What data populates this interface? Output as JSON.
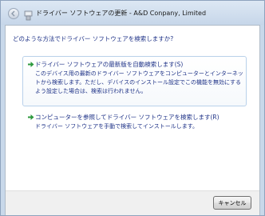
{
  "window": {
    "title": "ドライバー ソフトウェアの更新 - A&D Conpany, Limited"
  },
  "main": {
    "question": "どのような方法でドライバー ソフトウェアを検索しますか?",
    "options": [
      {
        "title": "ドライバー ソフトウェアの最新版を自動検索します(S)",
        "description": "このデバイス用の最新のドライバー ソフトウェアをコンピューターとインターネットから検索します。ただし、デバイスのインストール設定でこの機能を無効にするよう設定した場合は、検索は行われません。"
      },
      {
        "title": "コンピューターを参照してドライバー ソフトウェアを検索します(R)",
        "description": "ドライバー ソフトウェアを手動で検索してインストールします。"
      }
    ]
  },
  "footer": {
    "cancel_label": "キャンセル"
  },
  "colors": {
    "link_text": "#1e3287",
    "option_arrow": "#2e9a3e",
    "highlight_border": "#b9d1ea",
    "frame": "#c8d8ea"
  },
  "icons": {
    "back": "back-arrow-icon",
    "device": "device-driver-icon",
    "option": "green-arrow-icon"
  }
}
